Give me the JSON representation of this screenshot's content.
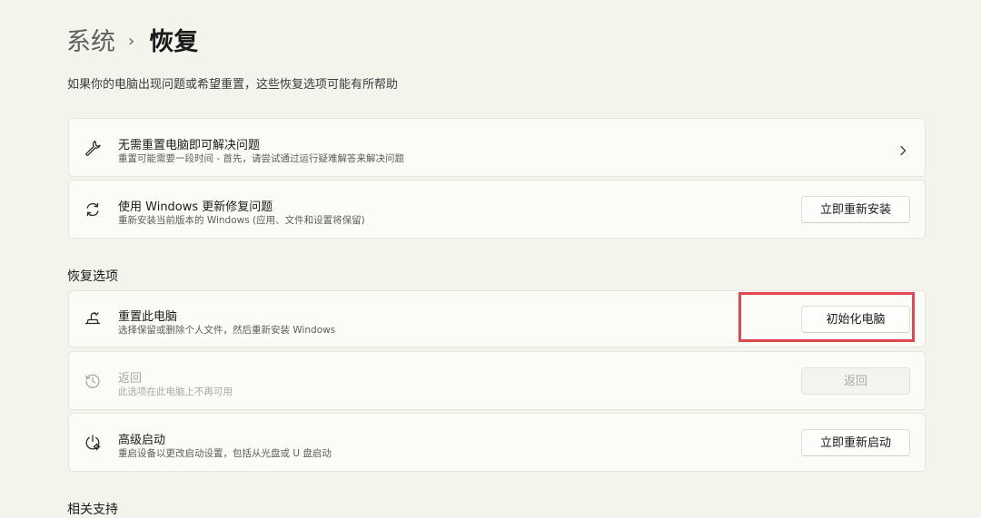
{
  "breadcrumb": {
    "parent": "系统",
    "separator": "›",
    "current": "恢复"
  },
  "subtitle": "如果你的电脑出现问题或希望重置，这些恢复选项可能有所帮助",
  "cards_top": [
    {
      "icon": "wrench-icon",
      "title": "无需重置电脑即可解决问题",
      "desc": "重置可能需要一段时间 - 首先，请尝试通过运行疑难解答来解决问题",
      "action": "chevron-right-icon"
    },
    {
      "icon": "refresh-icon",
      "title": "使用 Windows 更新修复问题",
      "desc": "重新安装当前版本的 Windows (应用、文件和设置将保留)",
      "button": "立即重新安装"
    }
  ],
  "recovery_section": {
    "title": "恢复选项",
    "reset": {
      "icon": "reset-pc-icon",
      "title": "重置此电脑",
      "desc": "选择保留或删除个人文件，然后重新安装 Windows",
      "button": "初始化电脑"
    },
    "go_back": {
      "icon": "history-icon",
      "title": "返回",
      "desc": "此选项在此电脑上不再可用",
      "button": "返回",
      "disabled": true
    },
    "advanced": {
      "icon": "advanced-startup-icon",
      "title": "高级启动",
      "desc": "重启设备以更改启动设置，包括从光盘或 U 盘启动",
      "button": "立即重新启动"
    }
  },
  "related_section": {
    "title": "相关支持"
  },
  "colors": {
    "background": "#f4f3ec",
    "card": "#fbfbf7",
    "highlight": "#e2484f"
  }
}
